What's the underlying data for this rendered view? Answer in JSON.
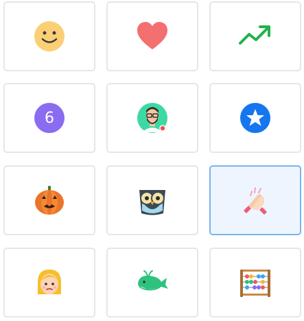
{
  "tiles": [
    {
      "icon": "smile-icon",
      "selected": false
    },
    {
      "icon": "heart-icon",
      "selected": false
    },
    {
      "icon": "trending-up-icon",
      "selected": false
    },
    {
      "icon": "number-badge-icon",
      "number": "6",
      "selected": false
    },
    {
      "icon": "avatar-icon",
      "selected": false
    },
    {
      "icon": "star-badge-icon",
      "selected": false
    },
    {
      "icon": "pumpkin-icon",
      "selected": false
    },
    {
      "icon": "owl-icon",
      "selected": false
    },
    {
      "icon": "clapping-hands-icon",
      "selected": true
    },
    {
      "icon": "girl-face-icon",
      "selected": false
    },
    {
      "icon": "whale-icon",
      "selected": false
    },
    {
      "icon": "abacus-icon",
      "selected": false
    }
  ],
  "colors": {
    "tile_border": "#e6e6e6",
    "selected_border": "#79b4ef",
    "selected_bg": "#eef5ff",
    "smile": "#fbcf75",
    "heart": "#f46f6f",
    "trend": "#22b14c",
    "number_badge": "#8a6cf0",
    "star_badge": "#1576f0"
  }
}
